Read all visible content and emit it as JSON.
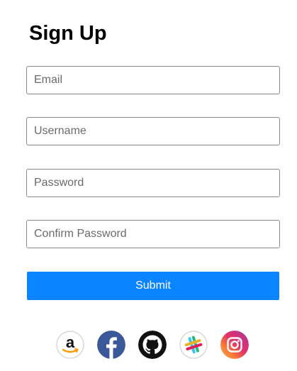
{
  "form": {
    "title": "Sign Up",
    "email_placeholder": "Email",
    "username_placeholder": "Username",
    "password_placeholder": "Password",
    "confirm_password_placeholder": "Confirm Password",
    "submit_label": "Submit"
  },
  "social": [
    {
      "icon": "amazon-icon"
    },
    {
      "icon": "facebook-icon"
    },
    {
      "icon": "github-icon"
    },
    {
      "icon": "slack-icon"
    },
    {
      "icon": "instagram-icon"
    }
  ],
  "colors": {
    "submit": "#0a84ff",
    "facebook": "#3b5998",
    "amazon_arrow": "#ff9900"
  }
}
